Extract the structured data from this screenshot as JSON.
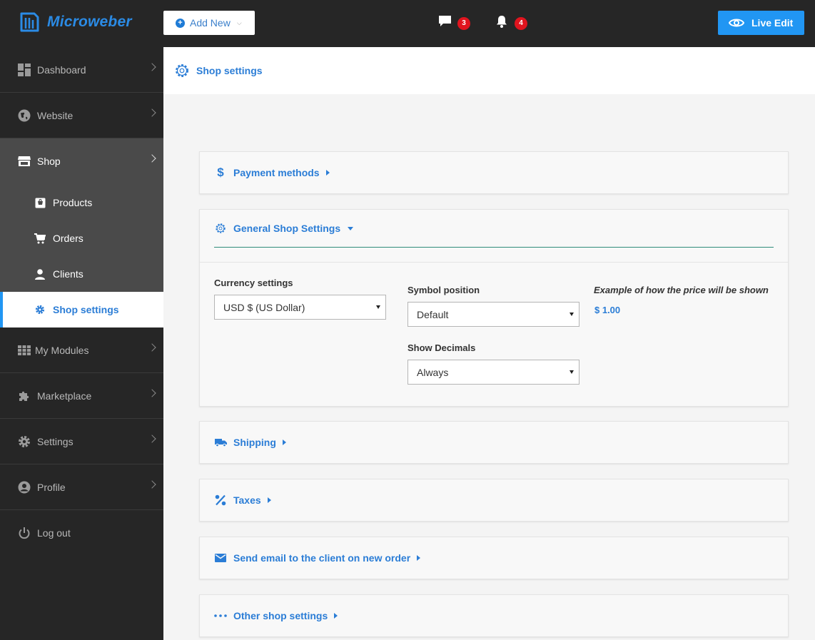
{
  "app": {
    "logo_text": "Microweber",
    "add_new_label": "Add New",
    "comments_count": "3",
    "notifications_count": "4",
    "live_edit_label": "Live Edit"
  },
  "sidebar": {
    "items": [
      {
        "label": "Dashboard",
        "icon": "dashboard-icon"
      },
      {
        "label": "Website",
        "icon": "globe-icon"
      },
      {
        "label": "Shop",
        "icon": "store-icon"
      },
      {
        "label": "My Modules",
        "icon": "grid-icon"
      },
      {
        "label": "Marketplace",
        "icon": "puzzle-icon"
      },
      {
        "label": "Settings",
        "icon": "gear-icon"
      },
      {
        "label": "Profile",
        "icon": "user-circle-icon"
      },
      {
        "label": "Log out",
        "icon": "power-icon"
      }
    ],
    "shop_sub": [
      {
        "label": "Products",
        "icon": "product-icon"
      },
      {
        "label": "Orders",
        "icon": "cart-icon"
      },
      {
        "label": "Clients",
        "icon": "person-icon"
      },
      {
        "label": "Shop settings",
        "icon": "cog-icon"
      }
    ]
  },
  "header": {
    "title": "Shop settings"
  },
  "sections": {
    "payment": "Payment methods",
    "general": "General Shop Settings",
    "shipping": "Shipping",
    "taxes": "Taxes",
    "email": "Send email to the client on new order",
    "other": "Other shop settings"
  },
  "general_settings": {
    "currency_label": "Currency settings",
    "currency_value": "USD $ (US Dollar)",
    "symbol_position_label": "Symbol position",
    "symbol_position_value": "Default",
    "show_decimals_label": "Show Decimals",
    "show_decimals_value": "Always",
    "example_label": "Example of how the price will be shown",
    "example_value": "$ 1.00"
  },
  "colors": {
    "accent": "#2b7dd6",
    "live_edit_bg": "#2196f3",
    "badge": "#e0141e",
    "sidebar_bg": "#262626",
    "sidebar_active_bg": "#4a4a4a",
    "divider_teal": "#2e8b7a"
  }
}
